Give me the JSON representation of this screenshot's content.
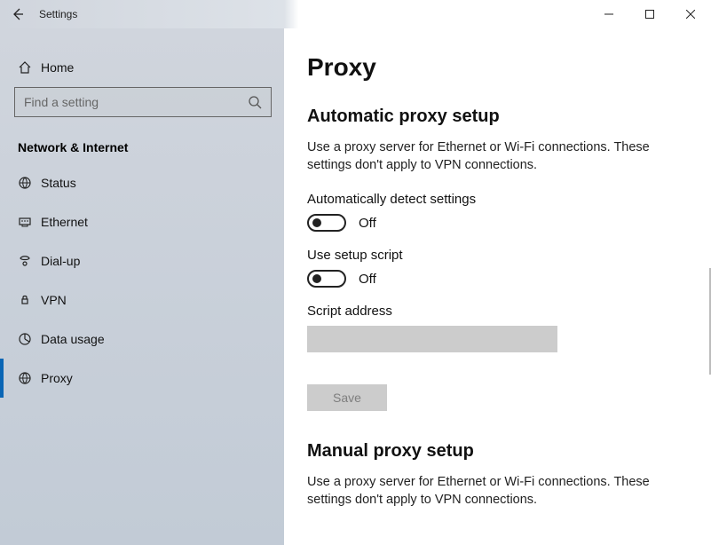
{
  "window": {
    "title": "Settings"
  },
  "sidebar": {
    "home": "Home",
    "search_placeholder": "Find a setting",
    "category": "Network & Internet",
    "items": [
      {
        "label": "Status"
      },
      {
        "label": "Ethernet"
      },
      {
        "label": "Dial-up"
      },
      {
        "label": "VPN"
      },
      {
        "label": "Data usage"
      },
      {
        "label": "Proxy"
      }
    ],
    "selected_index": 5
  },
  "page": {
    "title": "Proxy",
    "auto": {
      "heading": "Automatic proxy setup",
      "desc": "Use a proxy server for Ethernet or Wi-Fi connections. These settings don't apply to VPN connections.",
      "detect_label": "Automatically detect settings",
      "detect_state": "Off",
      "script_toggle_label": "Use setup script",
      "script_toggle_state": "Off",
      "script_addr_label": "Script address",
      "script_addr_value": "",
      "save_label": "Save"
    },
    "manual": {
      "heading": "Manual proxy setup",
      "desc": "Use a proxy server for Ethernet or Wi-Fi connections. These settings don't apply to VPN connections."
    }
  }
}
